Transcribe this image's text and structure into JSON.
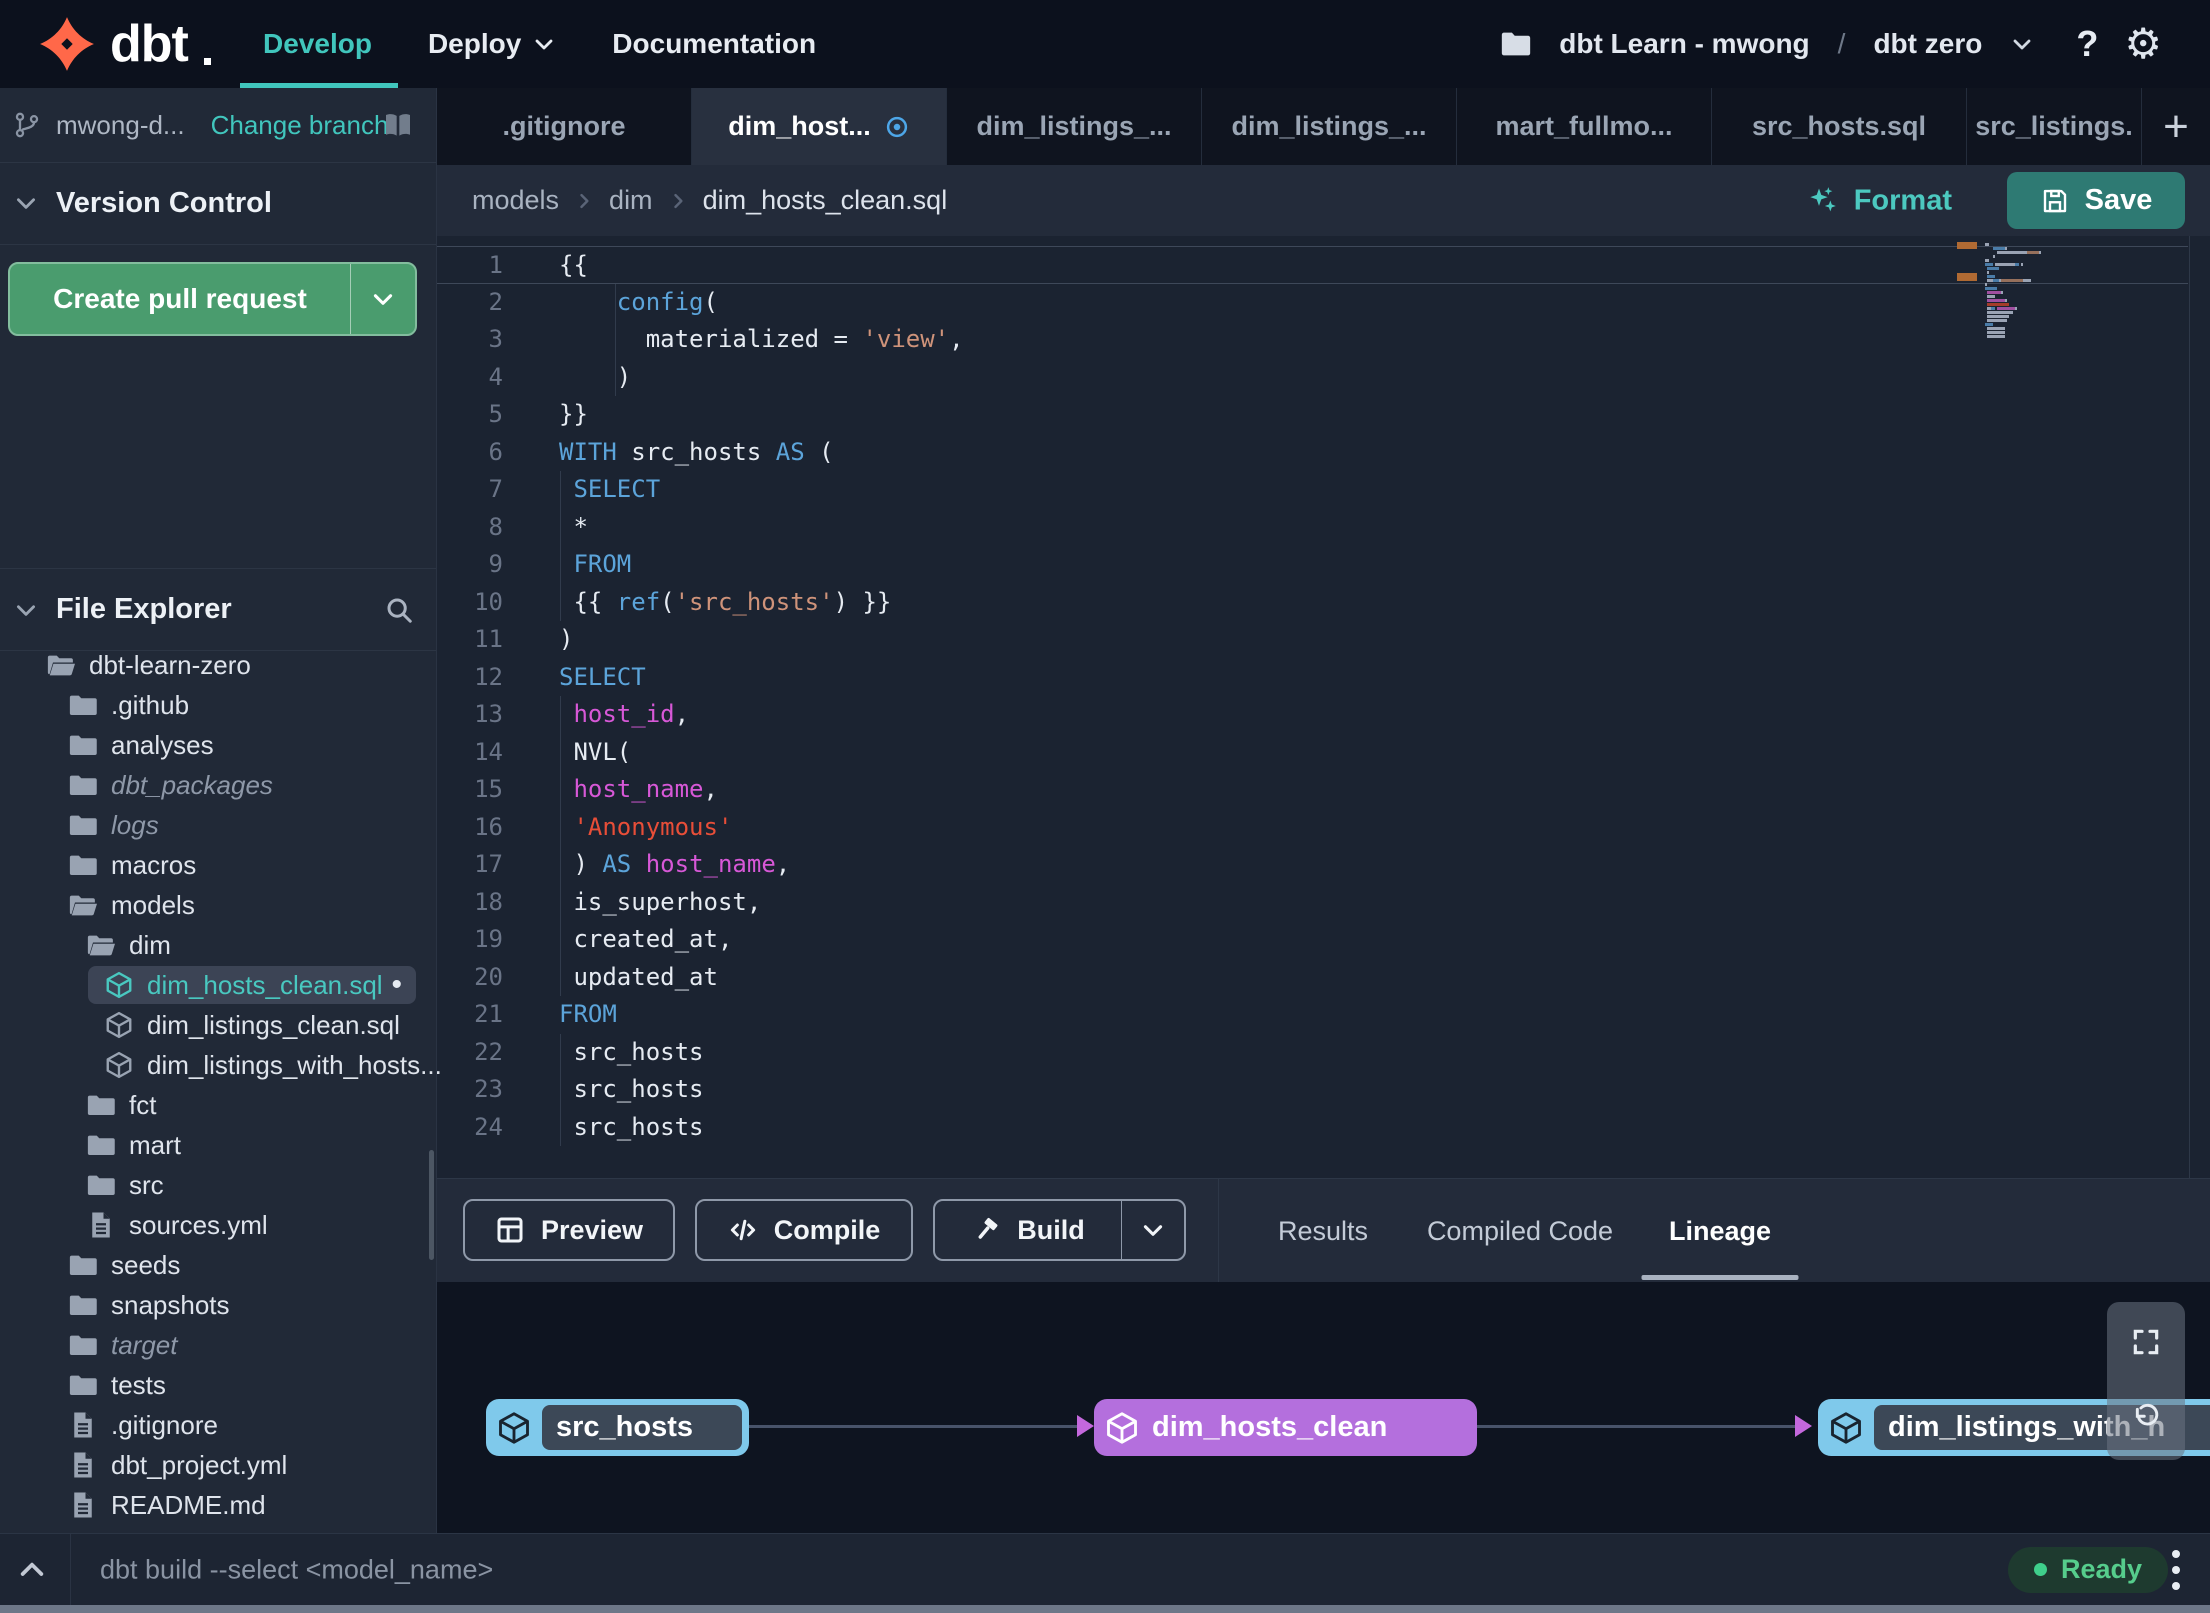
{
  "header": {
    "brand": "dbt",
    "nav": [
      {
        "label": "Develop",
        "active": true
      },
      {
        "label": "Deploy",
        "dropdown": true
      },
      {
        "label": "Documentation"
      }
    ],
    "project_folder": "dbt Learn - mwong",
    "project_sep": "/",
    "project_name": "dbt zero",
    "help": "?",
    "gear": "⚙"
  },
  "sidebar": {
    "branch_name": "mwong-d...",
    "change_branch": "Change branch",
    "version_control_title": "Version Control",
    "create_pr": "Create pull request",
    "file_explorer_title": "File Explorer",
    "tree": [
      {
        "label": "dbt-learn-zero",
        "type": "folder-open",
        "indent": 0
      },
      {
        "label": ".github",
        "type": "folder",
        "indent": 1
      },
      {
        "label": "analyses",
        "type": "folder",
        "indent": 1
      },
      {
        "label": "dbt_packages",
        "type": "folder",
        "indent": 1,
        "italic": true
      },
      {
        "label": "logs",
        "type": "folder",
        "indent": 1,
        "italic": true
      },
      {
        "label": "macros",
        "type": "folder",
        "indent": 1
      },
      {
        "label": "models",
        "type": "folder-open",
        "indent": 1
      },
      {
        "label": "dim",
        "type": "folder-open",
        "indent": 2
      },
      {
        "label": "dim_hosts_clean.sql",
        "type": "model",
        "indent": 3,
        "selected": true,
        "modified": true
      },
      {
        "label": "dim_listings_clean.sql",
        "type": "model",
        "indent": 3
      },
      {
        "label": "dim_listings_with_hosts...",
        "type": "model",
        "indent": 3
      },
      {
        "label": "fct",
        "type": "folder",
        "indent": 2
      },
      {
        "label": "mart",
        "type": "folder",
        "indent": 2
      },
      {
        "label": "src",
        "type": "folder",
        "indent": 2
      },
      {
        "label": "sources.yml",
        "type": "file",
        "indent": 2
      },
      {
        "label": "seeds",
        "type": "folder",
        "indent": 1
      },
      {
        "label": "snapshots",
        "type": "folder",
        "indent": 1
      },
      {
        "label": "target",
        "type": "folder",
        "indent": 1,
        "italic": true
      },
      {
        "label": "tests",
        "type": "folder",
        "indent": 1
      },
      {
        "label": ".gitignore",
        "type": "file",
        "indent": 1
      },
      {
        "label": "dbt_project.yml",
        "type": "file",
        "indent": 1
      },
      {
        "label": "README.md",
        "type": "file",
        "indent": 1
      }
    ]
  },
  "tabs": {
    "items": [
      {
        "label": ".gitignore"
      },
      {
        "label": "dim_host...",
        "active": true,
        "modified": true
      },
      {
        "label": "dim_listings_..."
      },
      {
        "label": "dim_listings_..."
      },
      {
        "label": "mart_fullmo..."
      },
      {
        "label": "src_hosts.sql"
      },
      {
        "label": "src_listings."
      }
    ],
    "add": "+"
  },
  "editor": {
    "breadcrumb": [
      "models",
      "dim",
      "dim_hosts_clean.sql"
    ],
    "format": "Format",
    "save": "Save",
    "lines": [
      {
        "n": 1,
        "current": true,
        "tok": [
          [
            "p",
            "{{"
          ]
        ]
      },
      {
        "n": 2,
        "tok": [
          [
            "p",
            "    "
          ],
          [
            "k",
            "config"
          ],
          [
            "p",
            "("
          ]
        ]
      },
      {
        "n": 3,
        "tok": [
          [
            "p",
            "      materialized = "
          ],
          [
            "s",
            "'view'"
          ],
          [
            "p",
            ","
          ]
        ]
      },
      {
        "n": 4,
        "tok": [
          [
            "p",
            "    )"
          ]
        ]
      },
      {
        "n": 5,
        "tok": [
          [
            "p",
            "}}"
          ]
        ]
      },
      {
        "n": 6,
        "tok": [
          [
            "k",
            "WITH"
          ],
          [
            "p",
            " src_hosts "
          ],
          [
            "k",
            "AS"
          ],
          [
            "p",
            " ("
          ]
        ]
      },
      {
        "n": 7,
        "tok": [
          [
            "p",
            " "
          ],
          [
            "k",
            "SELECT"
          ]
        ]
      },
      {
        "n": 8,
        "tok": [
          [
            "p",
            " *"
          ]
        ]
      },
      {
        "n": 9,
        "tok": [
          [
            "p",
            " "
          ],
          [
            "k",
            "FROM"
          ]
        ]
      },
      {
        "n": 10,
        "tok": [
          [
            "p",
            " {{ "
          ],
          [
            "k",
            "ref"
          ],
          [
            "p",
            "("
          ],
          [
            "s",
            "'src_hosts'"
          ],
          [
            "p",
            ") }}"
          ]
        ]
      },
      {
        "n": 11,
        "tok": [
          [
            "p",
            ")"
          ]
        ]
      },
      {
        "n": 12,
        "tok": [
          [
            "k",
            "SELECT"
          ]
        ]
      },
      {
        "n": 13,
        "tok": [
          [
            "p",
            " "
          ],
          [
            "c",
            "host_id"
          ],
          [
            "p",
            ","
          ]
        ]
      },
      {
        "n": 14,
        "tok": [
          [
            "p",
            " NVL("
          ]
        ]
      },
      {
        "n": 15,
        "tok": [
          [
            "p",
            " "
          ],
          [
            "c",
            "host_name"
          ],
          [
            "p",
            ","
          ]
        ]
      },
      {
        "n": 16,
        "tok": [
          [
            "p",
            " "
          ],
          [
            "r",
            "'Anonymous'"
          ]
        ]
      },
      {
        "n": 17,
        "tok": [
          [
            "p",
            " ) "
          ],
          [
            "k",
            "AS"
          ],
          [
            "p",
            " "
          ],
          [
            "c",
            "host_name"
          ],
          [
            "p",
            ","
          ]
        ]
      },
      {
        "n": 18,
        "tok": [
          [
            "p",
            " is_superhost,"
          ]
        ]
      },
      {
        "n": 19,
        "tok": [
          [
            "p",
            " created_at,"
          ]
        ]
      },
      {
        "n": 20,
        "tok": [
          [
            "p",
            " updated_at"
          ]
        ]
      },
      {
        "n": 21,
        "tok": [
          [
            "k",
            "FROM"
          ]
        ]
      },
      {
        "n": 22,
        "tok": [
          [
            "p",
            " src_hosts"
          ]
        ]
      },
      {
        "n": 23,
        "tok": [
          [
            "p",
            " src_hosts"
          ]
        ]
      },
      {
        "n": 24,
        "tok": [
          [
            "p",
            " src_hosts"
          ]
        ]
      }
    ]
  },
  "actions": {
    "preview": "Preview",
    "compile": "Compile",
    "build": "Build"
  },
  "results_tabs": [
    {
      "label": "Results"
    },
    {
      "label": "Compiled Code"
    },
    {
      "label": "Lineage",
      "active": true
    }
  ],
  "lineage": {
    "nodes": [
      {
        "label": "src_hosts",
        "kind": "source"
      },
      {
        "label": "dim_hosts_clean",
        "kind": "model"
      },
      {
        "label": "dim_listings_with_h",
        "kind": "source"
      }
    ]
  },
  "statusbar": {
    "command": "dbt build --select <model_name>",
    "ready": "Ready"
  },
  "colors": {
    "accent_teal": "#41c6bd",
    "save_teal": "#2e7a73",
    "pr_green": "#4a9c6e",
    "node_purple": "#b46fdd",
    "node_sky": "#7fc9eb",
    "ready_green": "#3fcf8b",
    "logo_orange": "#ff6849",
    "keyword_blue": "#5ca4da",
    "column_magenta": "#d758d7",
    "string_salmon": "#cf937a",
    "string_red": "#e84e38"
  }
}
